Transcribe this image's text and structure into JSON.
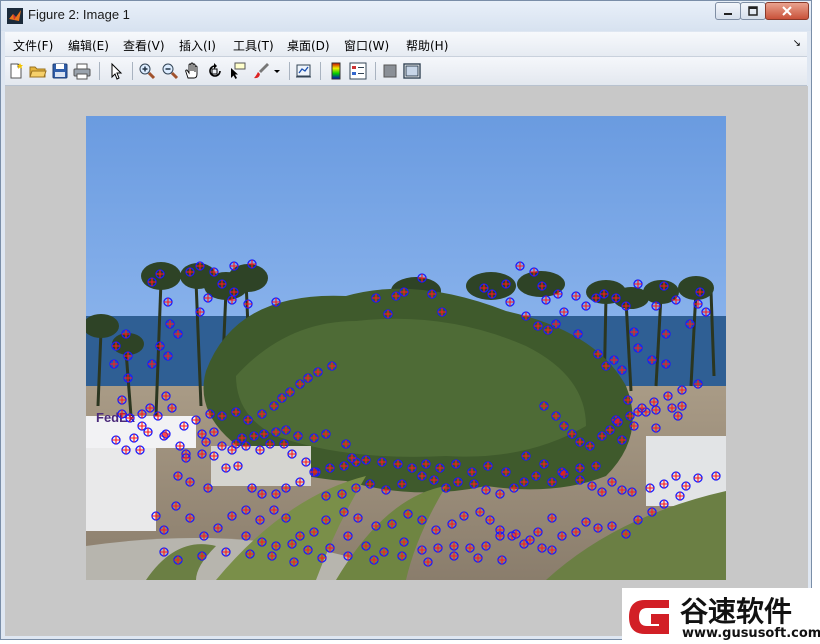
{
  "window": {
    "title": "Figure 2: Image 1"
  },
  "menu": [
    {
      "label": "文件(F)"
    },
    {
      "label": "编辑(E)"
    },
    {
      "label": "查看(V)"
    },
    {
      "label": "插入(I)"
    },
    {
      "label": "工具(T)"
    },
    {
      "label": "桌面(D)"
    },
    {
      "label": "窗口(W)"
    },
    {
      "label": "帮助(H)"
    }
  ],
  "toolbar": [
    {
      "icon": "new-figure-icon"
    },
    {
      "icon": "open-file-icon"
    },
    {
      "icon": "save-icon"
    },
    {
      "icon": "print-icon"
    },
    {
      "icon": "edit-plot-arrow-icon"
    },
    {
      "icon": "zoom-in-icon"
    },
    {
      "icon": "zoom-out-icon"
    },
    {
      "icon": "pan-hand-icon"
    },
    {
      "icon": "rotate-3d-icon"
    },
    {
      "icon": "data-cursor-icon"
    },
    {
      "icon": "brush-icon"
    },
    {
      "icon": "link-plot-icon"
    },
    {
      "icon": "colorbar-icon"
    },
    {
      "icon": "legend-icon"
    },
    {
      "icon": "hide-plot-tools-icon"
    },
    {
      "icon": "show-plot-tools-icon"
    }
  ],
  "image_labels": {
    "truck_text": "FedEx"
  },
  "watermark": {
    "brand": "谷速软件",
    "url": "www.gususoft.com"
  },
  "colors": {
    "marker_circle": "#1a1aff",
    "marker_plus": "#ff1a1a",
    "canvas_bg": "#c8c8c8"
  }
}
